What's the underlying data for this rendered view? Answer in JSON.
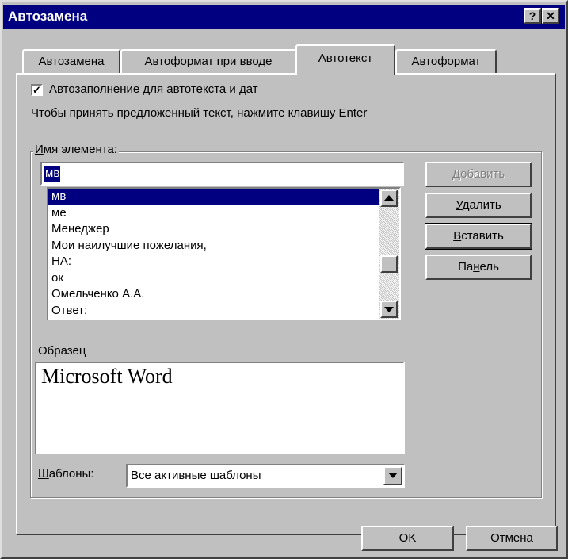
{
  "window": {
    "title": "Автозамена",
    "help_button": "?",
    "close_button": "✕"
  },
  "tabs": [
    {
      "label": "Автозамена"
    },
    {
      "label": "Автоформат при вводе"
    },
    {
      "label": "Автотекст",
      "active": true
    },
    {
      "label": "Автоформат"
    }
  ],
  "autocomplete": {
    "checked": true,
    "check_glyph": "✓",
    "label": "Автозаполнение для автотекста и дат",
    "label_accel": "А",
    "label_rest": "втозаполнение для автотекста и дат",
    "hint": "Чтобы принять предложенный текст, нажмите клавишу Enter"
  },
  "entry": {
    "legend_accel": "И",
    "legend_rest": "мя элемента:",
    "value": "мв"
  },
  "list": {
    "selected_index": 0,
    "items": [
      "мв",
      "ме",
      "Менеджер",
      "Мои наилучшие пожелания,",
      "НА:",
      "ок",
      "Омельченко А.А.",
      "Ответ:"
    ]
  },
  "buttons": {
    "add": "Добавить",
    "delete_accel": "У",
    "delete_rest": "далить",
    "insert_accel": "В",
    "insert_rest": "ставить",
    "toolbar_pre": "Па",
    "toolbar_accel": "н",
    "toolbar_rest": "ель"
  },
  "preview": {
    "label": "Образец",
    "text": "Microsoft Word"
  },
  "templates": {
    "label_accel": "Ш",
    "label_rest": "аблоны:",
    "selected": "Все активные шаблоны"
  },
  "footer": {
    "ok": "OK",
    "cancel": "Отмена"
  },
  "colors": {
    "titlebar": "#000080",
    "face": "#c0c0c0",
    "selection": "#000080"
  }
}
